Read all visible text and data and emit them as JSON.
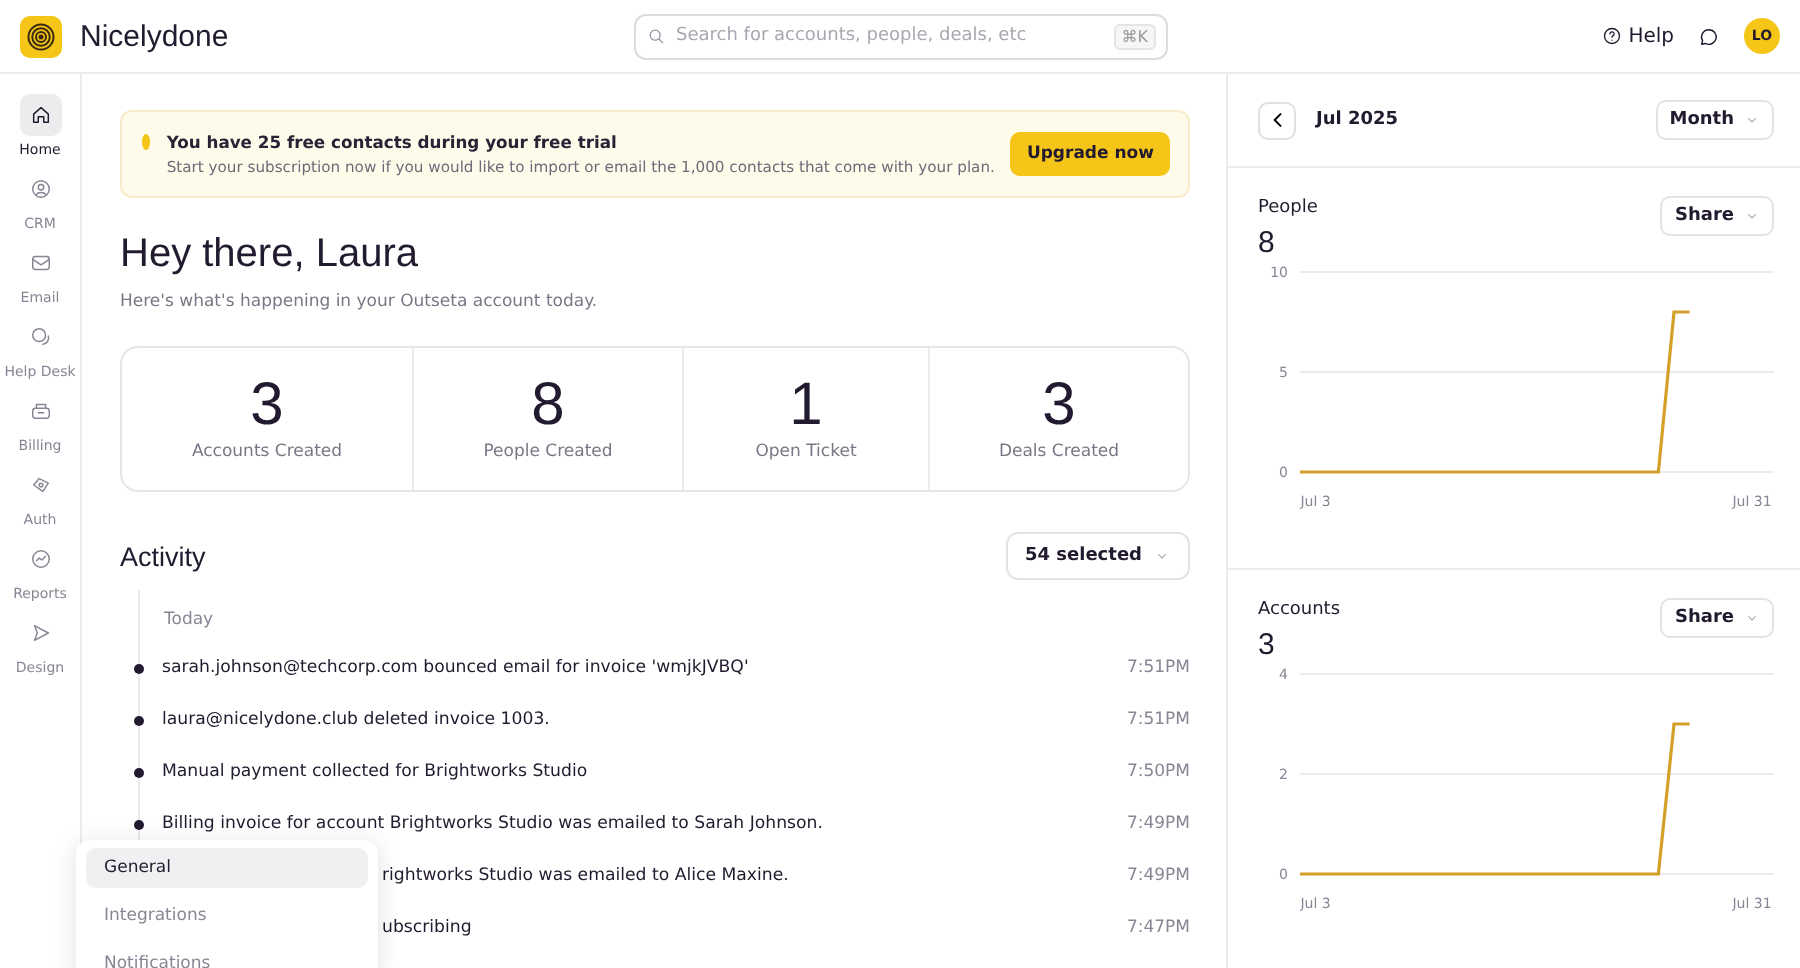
{
  "app": {
    "name": "Nicelydone"
  },
  "search": {
    "placeholder": "Search for accounts, people, deals, etc",
    "shortcut": "⌘K"
  },
  "header": {
    "help": "Help",
    "avatar": "LO"
  },
  "sidebar": {
    "items": [
      {
        "label": "Home",
        "selected": true
      },
      {
        "label": "CRM",
        "selected": false
      },
      {
        "label": "Email",
        "selected": false
      },
      {
        "label": "Help Desk",
        "selected": false
      },
      {
        "label": "Billing",
        "selected": false
      },
      {
        "label": "Auth",
        "selected": false
      },
      {
        "label": "Reports",
        "selected": false
      },
      {
        "label": "Design",
        "selected": false
      }
    ]
  },
  "banner": {
    "title": "You have 25 free contacts during your free trial",
    "text": "Start your subscription now if you would like to import or email the 1,000 contacts that come with your plan.",
    "button": "Upgrade now"
  },
  "greeting": {
    "title": "Hey there, Laura",
    "subtitle": "Here's what's happening in your Outseta account today."
  },
  "stats": [
    {
      "value": "3",
      "label": "Accounts Created"
    },
    {
      "value": "8",
      "label": "People Created"
    },
    {
      "value": "1",
      "label": "Open Ticket"
    },
    {
      "value": "3",
      "label": "Deals Created"
    }
  ],
  "activity": {
    "title": "Activity",
    "filter": "54 selected",
    "group": "Today",
    "items": [
      {
        "kind": "full",
        "text": "sarah.johnson@techcorp.com bounced email for invoice 'wmjkJVBQ'",
        "time": "7:51PM"
      },
      {
        "kind": "full",
        "text": "laura@nicelydone.club deleted invoice 1003.",
        "time": "7:51PM"
      },
      {
        "kind": "full",
        "text": "Manual payment collected for Brightworks Studio",
        "time": "7:50PM"
      },
      {
        "kind": "full",
        "text": "Billing invoice for account Brightworks Studio was emailed to Sarah Johnson.",
        "time": "7:49PM"
      },
      {
        "kind": "covered",
        "text": "rightworks Studio was emailed to Alice Maxine.",
        "time": "7:49PM"
      },
      {
        "kind": "covered",
        "text": "ubscribing",
        "time": "7:47PM"
      }
    ]
  },
  "menu": {
    "items": [
      {
        "label": "General",
        "selected": true
      },
      {
        "label": "Integrations",
        "selected": false
      },
      {
        "label": "Notifications",
        "selected": false
      }
    ]
  },
  "panel": {
    "period": "Jul 2025",
    "range": "Month",
    "sections": [
      {
        "title": "People",
        "value": "8",
        "share": "Share",
        "chart_data": {
          "type": "line",
          "categories": [
            null,
            "Jul 3",
            null,
            null,
            null,
            null,
            null,
            null,
            null,
            null,
            null,
            null,
            null,
            null,
            null,
            null,
            null,
            null,
            null,
            null,
            null,
            null,
            null,
            null,
            null,
            null,
            null,
            null,
            null,
            "Jul 31"
          ],
          "ylim": [
            0,
            10
          ],
          "yticks": [
            0,
            5,
            10
          ],
          "series": [
            {
              "color": "#d4a02a",
              "values": [
                0,
                0,
                0,
                0,
                0,
                0,
                0,
                0,
                0,
                0,
                0,
                0,
                0,
                0,
                0,
                0,
                0,
                0,
                0,
                0,
                0,
                0,
                0,
                0,
                8,
                8,
                null,
                null,
                null,
                null
              ]
            }
          ]
        }
      },
      {
        "title": "Accounts",
        "value": "3",
        "share": "Share",
        "chart_data": {
          "type": "line",
          "categories": [
            null,
            "Jul 3",
            null,
            null,
            null,
            null,
            null,
            null,
            null,
            null,
            null,
            null,
            null,
            null,
            null,
            null,
            null,
            null,
            null,
            null,
            null,
            null,
            null,
            null,
            null,
            null,
            null,
            null,
            null,
            "Jul 31"
          ],
          "ylim": [
            0,
            4
          ],
          "yticks": [
            0,
            2,
            4
          ],
          "series": [
            {
              "color": "#d4a02a",
              "values": [
                0,
                0,
                0,
                0,
                0,
                0,
                0,
                0,
                0,
                0,
                0,
                0,
                0,
                0,
                0,
                0,
                0,
                0,
                0,
                0,
                0,
                0,
                0,
                0,
                3,
                3,
                null,
                null,
                null,
                null
              ]
            }
          ]
        }
      }
    ]
  }
}
